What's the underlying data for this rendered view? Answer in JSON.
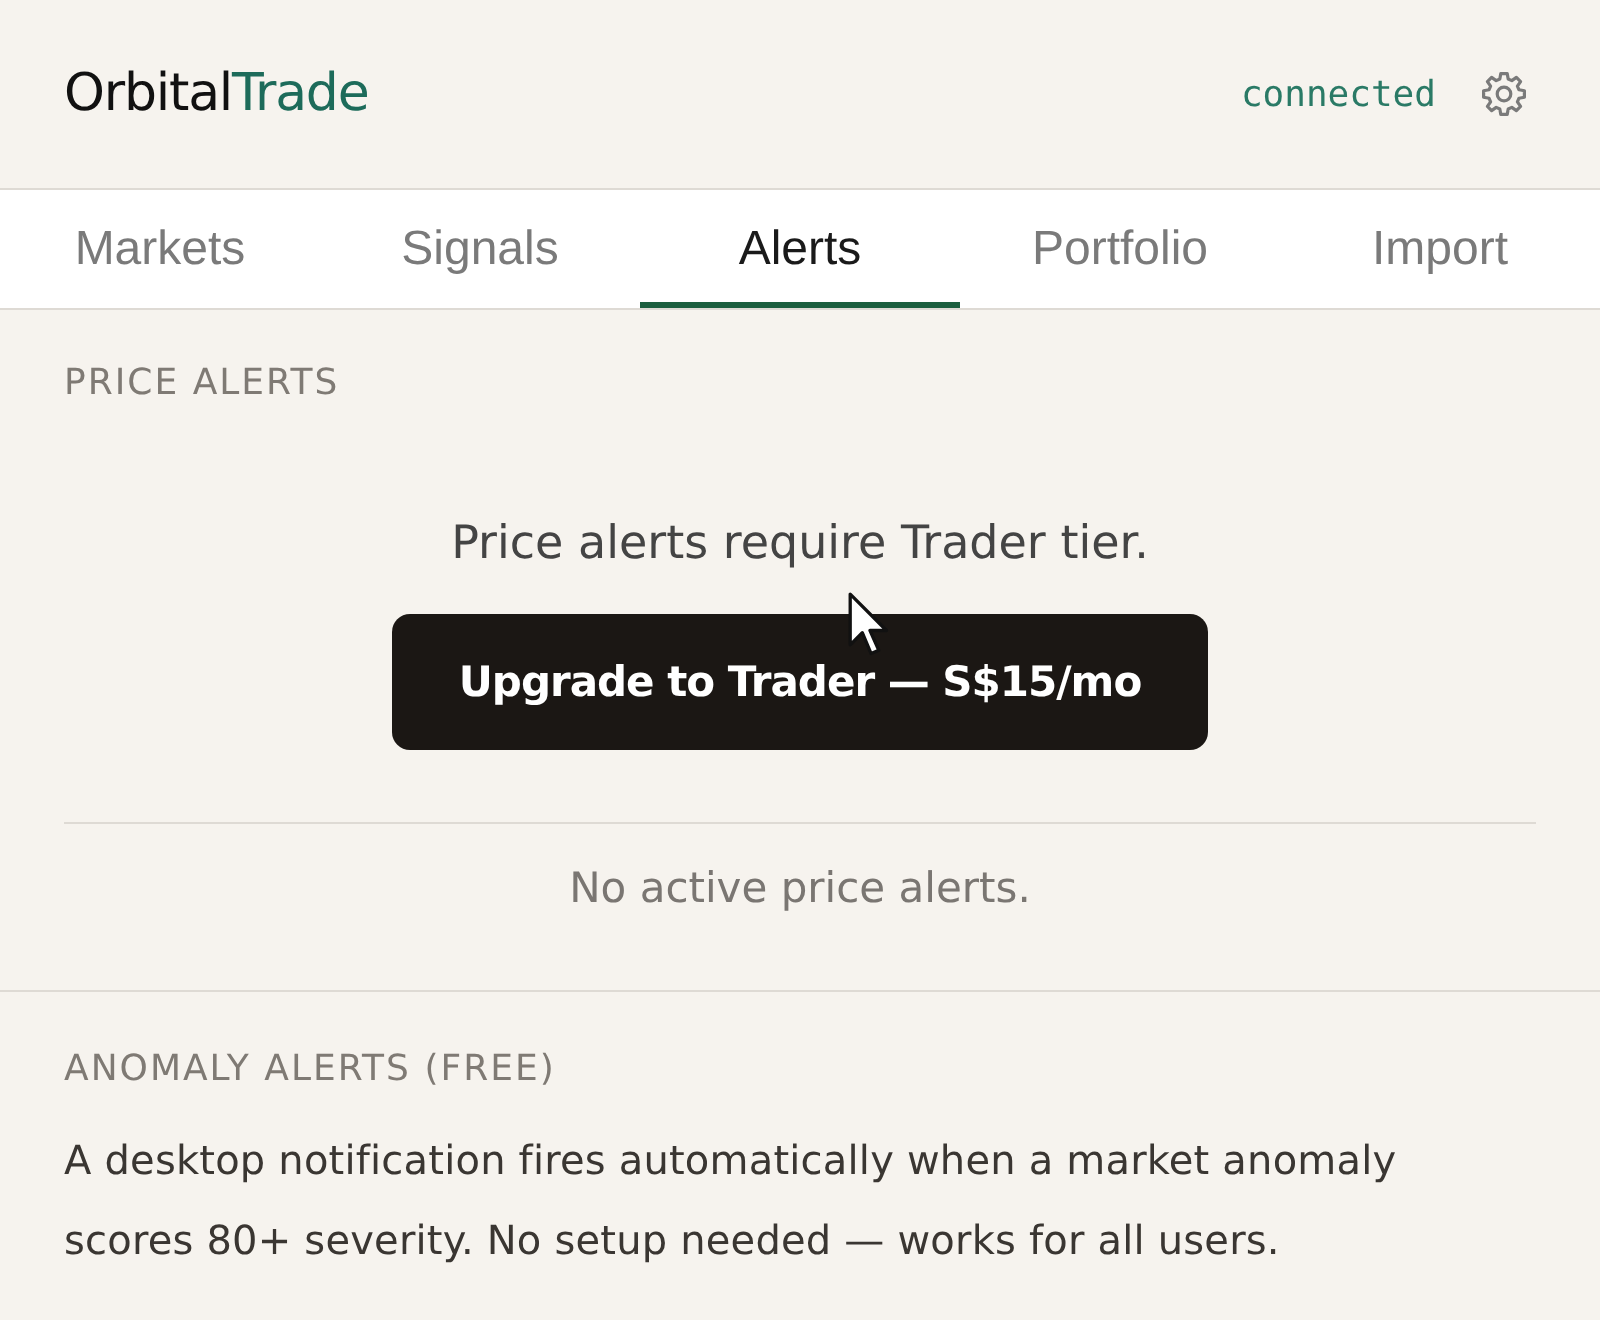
{
  "header": {
    "brand": {
      "name": "Orbital",
      "accent": "Trade"
    },
    "connection_status": "connected"
  },
  "tabs": [
    {
      "label": "Markets",
      "selected": false
    },
    {
      "label": "Signals",
      "selected": false
    },
    {
      "label": "Alerts",
      "selected": true
    },
    {
      "label": "Portfolio",
      "selected": false
    },
    {
      "label": "Import",
      "selected": false
    }
  ],
  "price_alerts": {
    "heading": "PRICE ALERTS",
    "message": "Price alerts require Trader tier.",
    "upgrade_button": "Upgrade to Trader — S$15/mo",
    "empty_state": "No active price alerts."
  },
  "anomaly_alerts": {
    "heading": "ANOMALY ALERTS (FREE)",
    "description": "A desktop notification fires automatically when a market anomaly scores 80+ severity. No setup needed — works for all users."
  }
}
